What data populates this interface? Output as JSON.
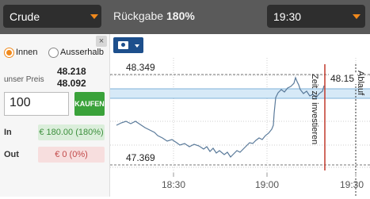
{
  "topbar": {
    "asset": "Crude",
    "payout_label": "Rückgabe",
    "payout_value": "180%",
    "expiry_time": "19:30"
  },
  "panel": {
    "close": "×",
    "option_in": "Innen",
    "option_out": "Ausserhalb",
    "our_price_label": "unser Preis",
    "price_high": "48.218",
    "price_low": "48.092",
    "amount": "100",
    "buy_button": "KAUFEN",
    "in_label": "In",
    "in_value": "€ 180.00 (180%)",
    "out_label": "Out",
    "out_value": "€ 0 (0%)"
  },
  "chart": {
    "upper_level": "48.349",
    "lower_level": "47.369",
    "current_price": "48.15",
    "invest_line_label": "Zeit zu investieren",
    "expiry_line_label": "Ablauf",
    "x_ticks": [
      "18:30",
      "19:00",
      "19:30"
    ],
    "colors": {
      "price_line": "#5a7a9a",
      "band": "#d6e9f7",
      "invest_line": "#c0392b",
      "accent": "#f0891c",
      "buy": "#3aa23a"
    }
  }
}
